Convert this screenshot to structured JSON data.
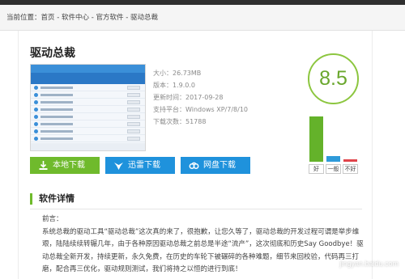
{
  "breadcrumb": {
    "label": "当前位置：",
    "home": "首页",
    "sep": " - ",
    "center": "软件中心",
    "official": "官方软件",
    "current": "驱动总裁"
  },
  "app": {
    "title": "驱动总裁",
    "size": "大小：26.73MB",
    "version": "版本：1.9.0.0",
    "updated": "更新时间：2017-09-28",
    "system": "支持平台：Windows XP/7/8/10",
    "downloads": "下载次数：51788"
  },
  "rating": {
    "score": "8.5",
    "good_label": "好",
    "mid_label": "一般",
    "bad_label": "不好",
    "good_fraction": 0.93,
    "mid_fraction": 0.12,
    "bad_fraction": 0.05,
    "colors": {
      "good": "#64b22a",
      "mid": "#2e9ad9",
      "bad": "#e0444a"
    }
  },
  "buttons": {
    "local": "本地下载",
    "thunder": "迅雷下载",
    "disk": "网盘下载"
  },
  "details": {
    "heading": "软件详情",
    "preface": "前言：",
    "body": "系统总裁的驱动工具“驱动总裁”这次真的来了，很抱歉，让您久等了，驱动总裁的开发过程可谓是举步维艰，陆陆续续转辗几年，由于各种原因驱动总裁之前总是半途“流产”，这次彻底和历史Say Goodbye！驱动总裁全新开发，持续更新，永久免费，在历史的车轮下被碾碎的各种难题，细节来回校验，代码再三打磨，配合再三优化，驱动规则测试，我们将持之以恒的进行到底！"
  },
  "watermark": "jingyan.baidu.com",
  "icons": [
    "download-icon",
    "thunder-bird-icon",
    "cloud-disk-icon"
  ]
}
